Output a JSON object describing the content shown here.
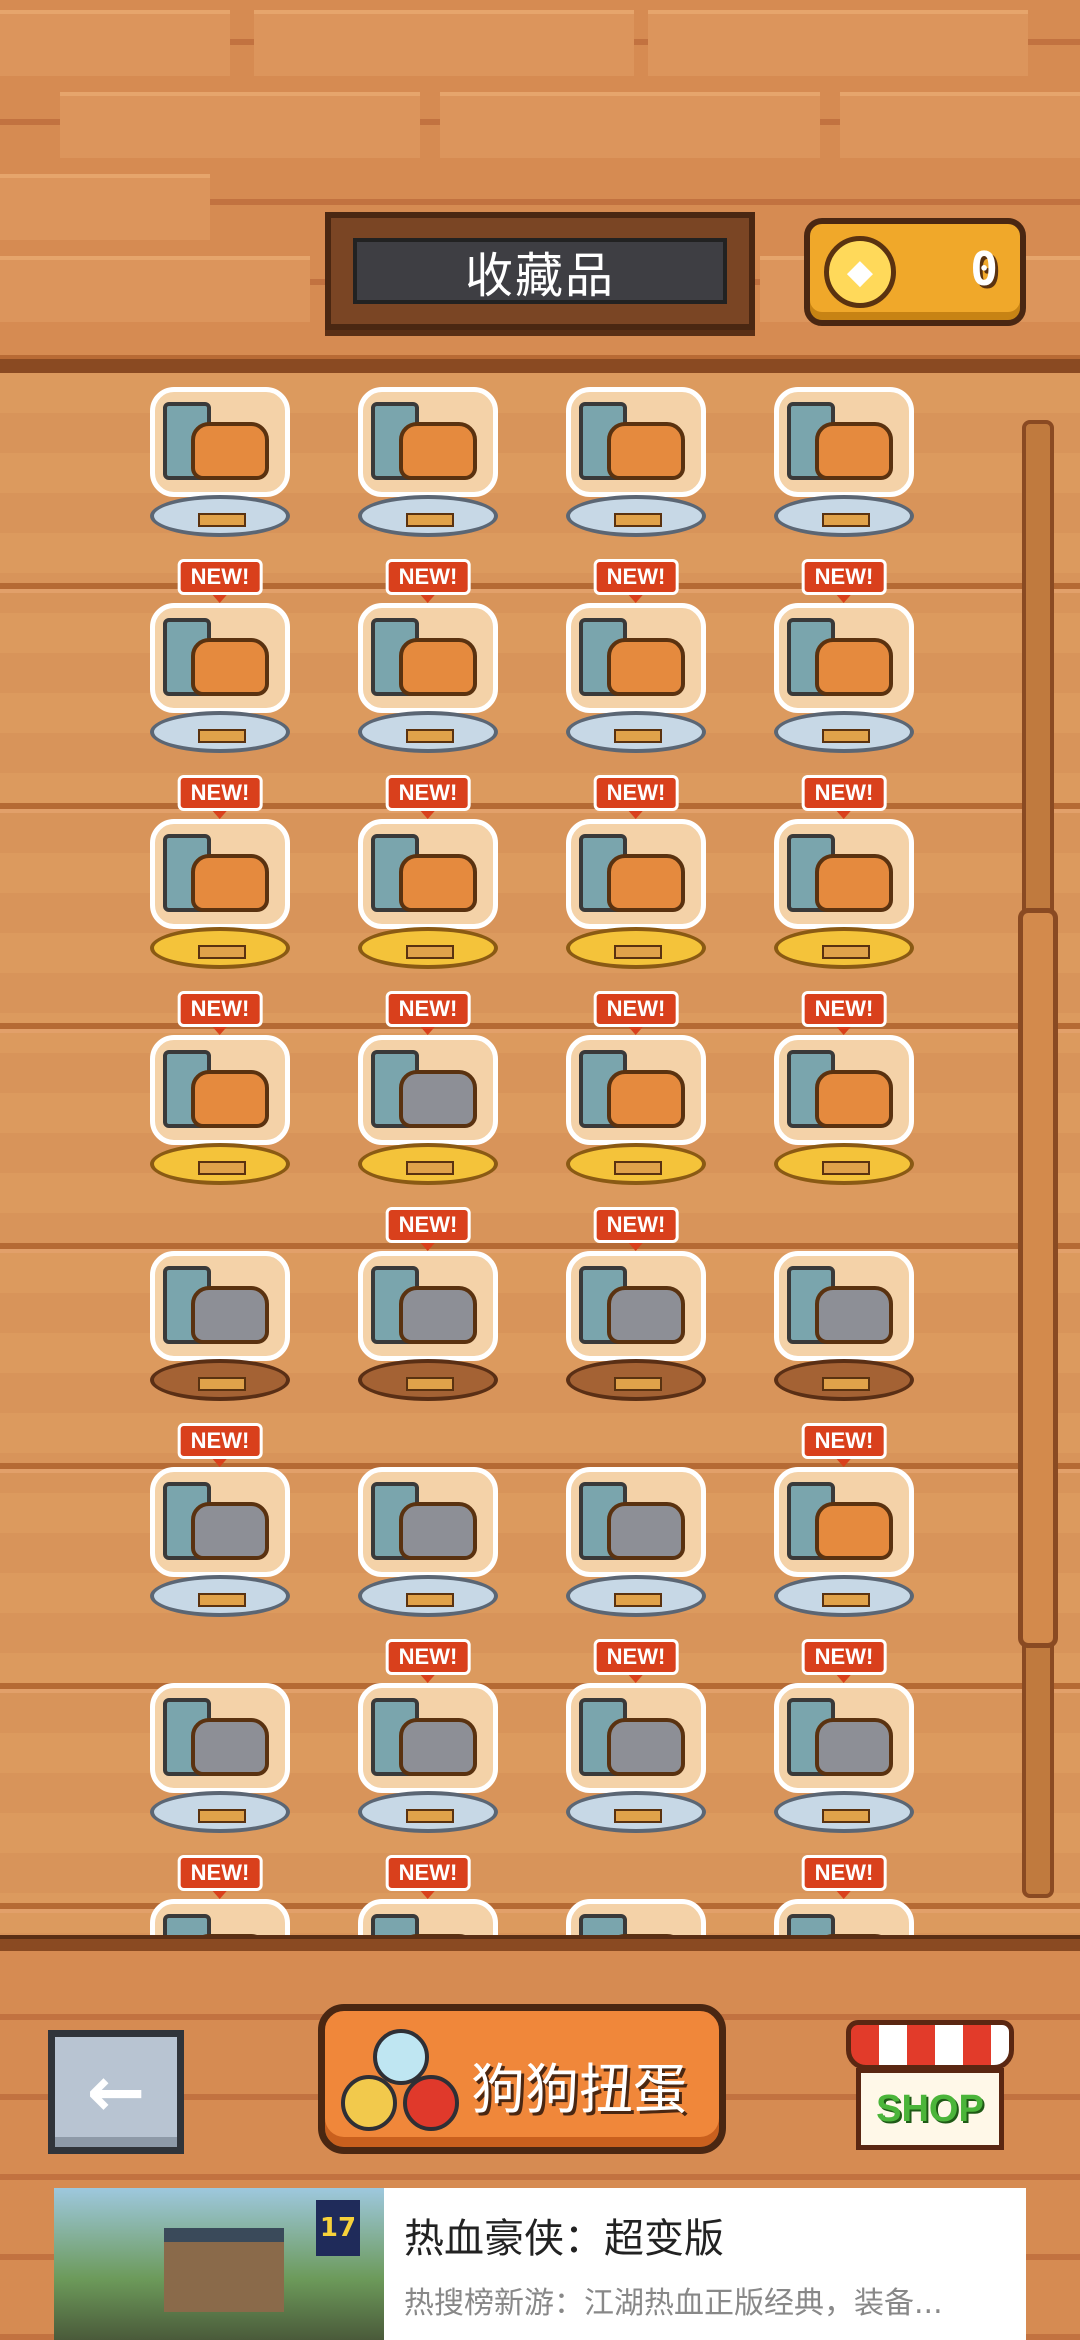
{
  "header": {
    "title": "收藏品",
    "coin_count": "0",
    "coin_icon": "gold-coin-icon"
  },
  "collection": {
    "items": [
      {
        "name": "sofa-dog",
        "new": false,
        "pedestal": "silver"
      },
      {
        "name": "tv-stand",
        "new": false,
        "pedestal": "silver"
      },
      {
        "name": "flower-bed",
        "new": false,
        "pedestal": "silver"
      },
      {
        "name": "red-cushion-dog",
        "new": false,
        "pedestal": "silver"
      },
      {
        "name": "owner-with-dog",
        "new": true,
        "pedestal": "silver"
      },
      {
        "name": "dining-table-dog",
        "new": true,
        "pedestal": "silver"
      },
      {
        "name": "balloon-dog",
        "new": true,
        "pedestal": "silver"
      },
      {
        "name": "tea-party-dog",
        "new": true,
        "pedestal": "silver"
      },
      {
        "name": "bathtub-dog",
        "new": true,
        "pedestal": "gold"
      },
      {
        "name": "mirror-dog",
        "new": true,
        "pedestal": "gold"
      },
      {
        "name": "table-chair-dog",
        "new": true,
        "pedestal": "gold"
      },
      {
        "name": "arched-door",
        "new": true,
        "pedestal": "gold"
      },
      {
        "name": "tea-set-dog",
        "new": true,
        "pedestal": "gold"
      },
      {
        "name": "gacha-capsule-cat",
        "new": true,
        "pedestal": "gold"
      },
      {
        "name": "golden-bed-dog",
        "new": true,
        "pedestal": "gold"
      },
      {
        "name": "dish-pile-dog",
        "new": true,
        "pedestal": "gold"
      },
      {
        "name": "gray-cat-sitting",
        "new": false,
        "pedestal": "bronze"
      },
      {
        "name": "floor-lamp-cat",
        "new": true,
        "pedestal": "bronze"
      },
      {
        "name": "fridge-cat",
        "new": true,
        "pedestal": "bronze"
      },
      {
        "name": "plant-stool-cat",
        "new": false,
        "pedestal": "bronze"
      },
      {
        "name": "window-cat",
        "new": true,
        "pedestal": "silver"
      },
      {
        "name": "dog-and-cat-duo",
        "new": false,
        "pedestal": "silver"
      },
      {
        "name": "sofa-dog-cat",
        "new": false,
        "pedestal": "silver"
      },
      {
        "name": "round-window-pets",
        "new": true,
        "pedestal": "silver"
      },
      {
        "name": "arched-door-cat",
        "new": false,
        "pedestal": "silver"
      },
      {
        "name": "armchair-cat",
        "new": true,
        "pedestal": "silver"
      },
      {
        "name": "computer-desk-cat",
        "new": true,
        "pedestal": "silver"
      },
      {
        "name": "blue-cushion-cat",
        "new": true,
        "pedestal": "silver"
      },
      {
        "name": "kitchen-counter",
        "new": true,
        "pedestal": "silver"
      },
      {
        "name": "pets-group",
        "new": true,
        "pedestal": "silver"
      },
      {
        "name": "glass-dome-cat",
        "new": false,
        "pedestal": "silver"
      },
      {
        "name": "white-dog-pair",
        "new": true,
        "pedestal": "silver"
      }
    ],
    "new_label": "NEW!"
  },
  "footer": {
    "back_icon": "left-arrow-icon",
    "gacha_label": "狗狗扭蛋",
    "shop_label": "SHOP"
  },
  "ad": {
    "title": "热血豪侠：超变版",
    "description": "热搜榜新游：江湖热血正版经典，装备...",
    "badge": "17"
  }
}
